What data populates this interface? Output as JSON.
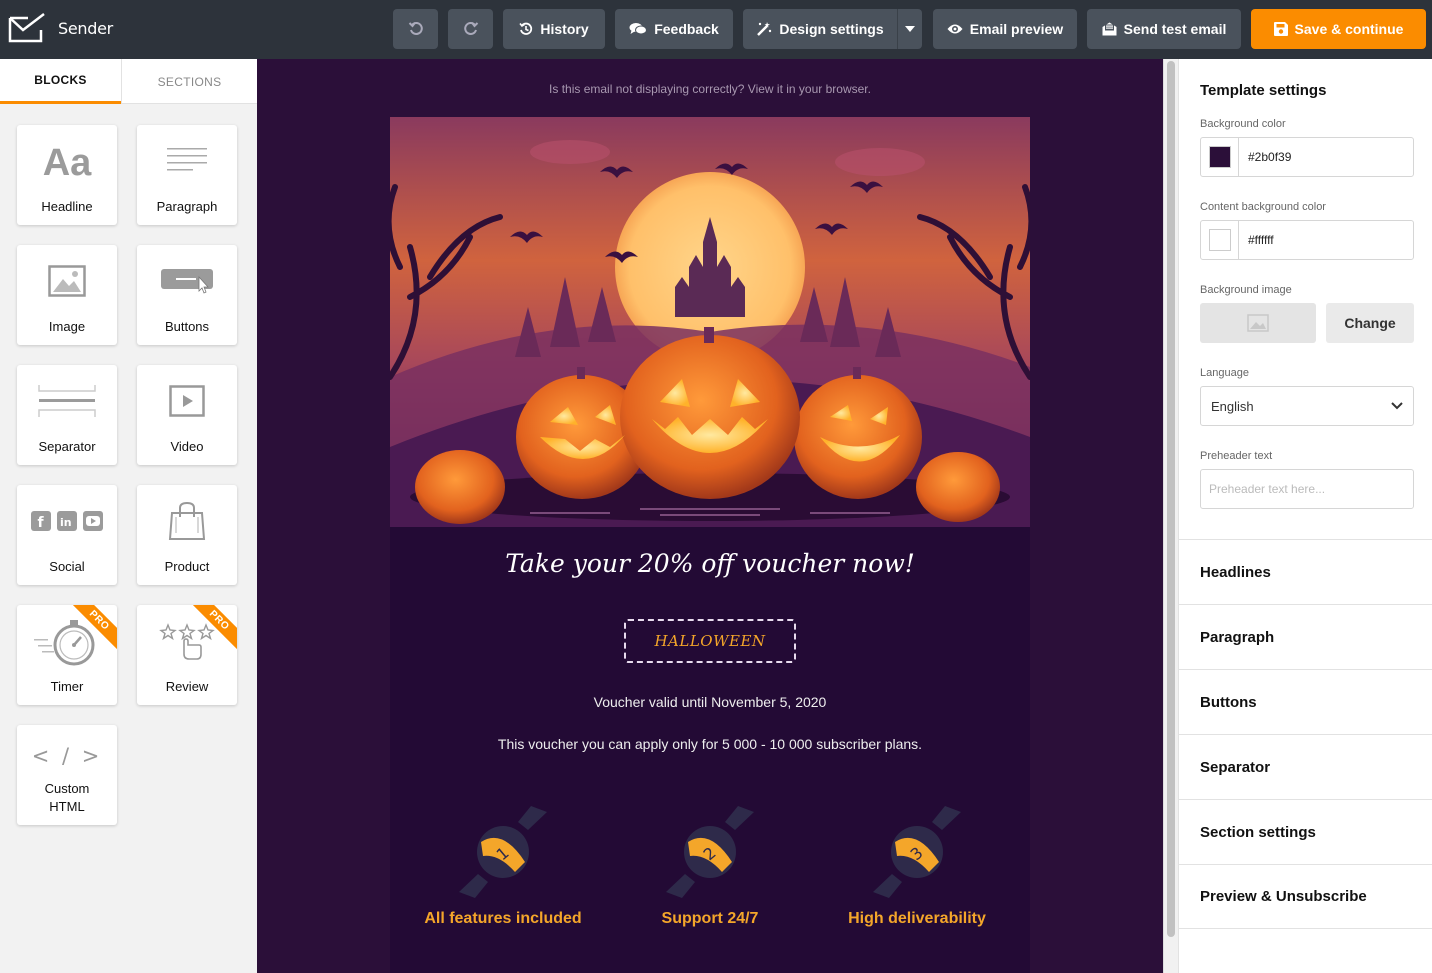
{
  "app": {
    "name": "Sender"
  },
  "toolbar": {
    "history": "History",
    "feedback": "Feedback",
    "design_settings": "Design settings",
    "email_preview": "Email preview",
    "send_test": "Send test email",
    "save": "Save & continue"
  },
  "left_panel": {
    "tabs": [
      "BLOCKS",
      "SECTIONS"
    ],
    "blocks": [
      "Headline",
      "Paragraph",
      "Image",
      "Buttons",
      "Separator",
      "Video",
      "Social",
      "Product",
      "Timer",
      "Review",
      "Custom",
      "HTML"
    ],
    "pro_badge": "PRO",
    "headline_icon_text": "Aa",
    "html_icon_text": "< / >"
  },
  "email": {
    "view_in_browser": "Is this email not displaying correctly? View it in your browser.",
    "headline": "Take your 20% off voucher now!",
    "voucher_code": "HALLOWEEN",
    "valid_text": "Voucher valid until November 5, 2020",
    "apply_text": "This voucher you can apply only for 5 000 - 10 000 subscriber plans.",
    "features": [
      {
        "number": "1",
        "title": "All features included"
      },
      {
        "number": "2",
        "title": "Support 24/7"
      },
      {
        "number": "3",
        "title": "High deliverability"
      }
    ]
  },
  "right_panel": {
    "title": "Template settings",
    "bg_color_label": "Background color",
    "bg_color": "#2b0f39",
    "content_bg_label": "Content background color",
    "content_bg": "#ffffff",
    "bg_image_label": "Background image",
    "change_label": "Change",
    "language_label": "Language",
    "language": "English",
    "preheader_label": "Preheader text",
    "preheader_placeholder": "Preheader text here...",
    "sections": [
      "Headlines",
      "Paragraph",
      "Buttons",
      "Separator",
      "Section settings",
      "Preview & Unsubscribe"
    ]
  },
  "colors": {
    "accent": "#fb8c00",
    "toolbar": "#2d333b",
    "feature_title": "#f4a62a"
  }
}
